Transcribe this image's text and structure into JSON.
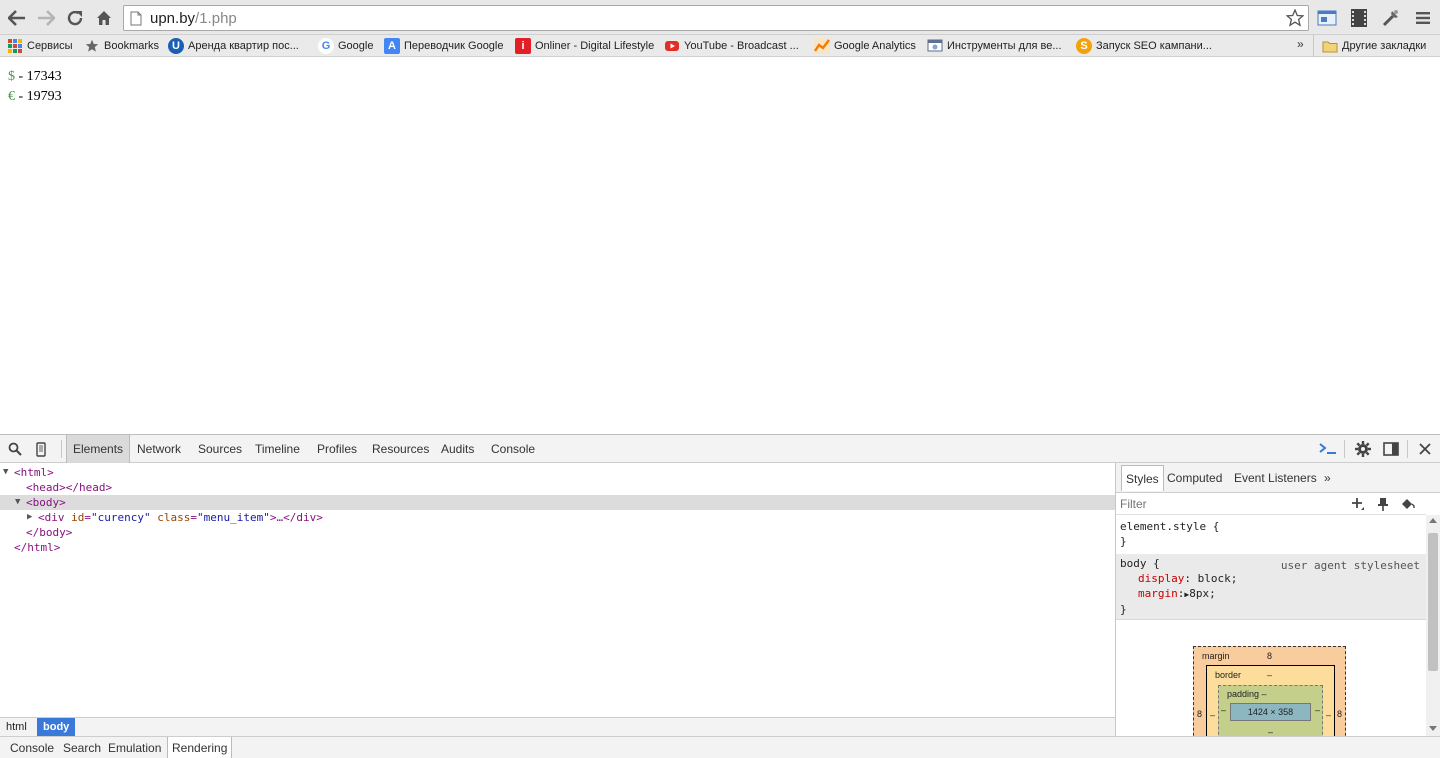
{
  "browser": {
    "url_host": "upn.by",
    "url_path": "/1.php",
    "icons": {
      "back": "back-arrow-icon",
      "forward": "forward-arrow-icon",
      "reload": "reload-icon",
      "home": "home-icon",
      "star": "star-icon",
      "menu": "hamburger-menu-icon"
    }
  },
  "bookmarks": {
    "items": [
      {
        "label": "Сервисы",
        "icon": "apps-grid-icon",
        "color": "#d34836"
      },
      {
        "label": "Bookmarks",
        "icon": "star-icon",
        "color": "#666666"
      },
      {
        "label": "Аренда квартир пос...",
        "icon": "u-logo-icon",
        "color": "#1a5fb4"
      },
      {
        "label": "Google",
        "icon": "google-g-icon",
        "color": "#4285f4"
      },
      {
        "label": "Переводчик Google",
        "icon": "translate-icon",
        "color": "#4285f4"
      },
      {
        "label": "Onliner - Digital Lifestyle",
        "icon": "onliner-icon",
        "color": "#e21f26"
      },
      {
        "label": "YouTube - Broadcast ...",
        "icon": "youtube-icon",
        "color": "#e52d27"
      },
      {
        "label": "Google Analytics",
        "icon": "analytics-icon",
        "color": "#f57c00"
      },
      {
        "label": "Инструменты для ве...",
        "icon": "webmaster-tools-icon",
        "color": "#5f6f8f"
      },
      {
        "label": "Запуск SEO кампани...",
        "icon": "seo-s-icon",
        "color": "#f4a20b"
      }
    ],
    "more": "»",
    "other_folder": "Другие закладки"
  },
  "page": {
    "rates": [
      {
        "symbol": "$",
        "text": " - 17343"
      },
      {
        "symbol": "€",
        "text": " - 19793"
      }
    ]
  },
  "devtools": {
    "tabs": [
      "Elements",
      "Network",
      "Sources",
      "Timeline",
      "Profiles",
      "Resources",
      "Audits",
      "Console"
    ],
    "active_tab": "Elements",
    "dom": {
      "html_open": "<html>",
      "head": "<head></head>",
      "body_open": "<body>",
      "div_tag_open": "<div",
      "div_attr1_name": "id",
      "div_attr1_value": "\"curency\"",
      "div_attr2_name": "class",
      "div_attr2_value": "\"menu_item\"",
      "div_tail": ">…</div>",
      "body_close": "</body>",
      "html_close": "</html>"
    },
    "breadcrumbs": [
      "html",
      "body"
    ],
    "drawer_tabs": [
      "Console",
      "Search",
      "Emulation",
      "Rendering"
    ],
    "sidebar": {
      "tabs": [
        "Styles",
        "Computed",
        "Event Listeners"
      ],
      "more": "»",
      "filter_placeholder": "Filter",
      "element_style_open": "element.style {",
      "close_brace": "}",
      "body_selector": "body {",
      "ua_source": "user agent stylesheet",
      "prop1_name": "display",
      "prop1_value": ": block;",
      "prop2_name": "margin",
      "prop2_value": "8px;",
      "box_model": {
        "margin_label": "margin",
        "margin_value": "8",
        "border_label": "border",
        "border_value": "–",
        "padding_label": "padding –",
        "content_size": "1424 × 358",
        "side_value": "8",
        "dash": "–"
      }
    }
  }
}
